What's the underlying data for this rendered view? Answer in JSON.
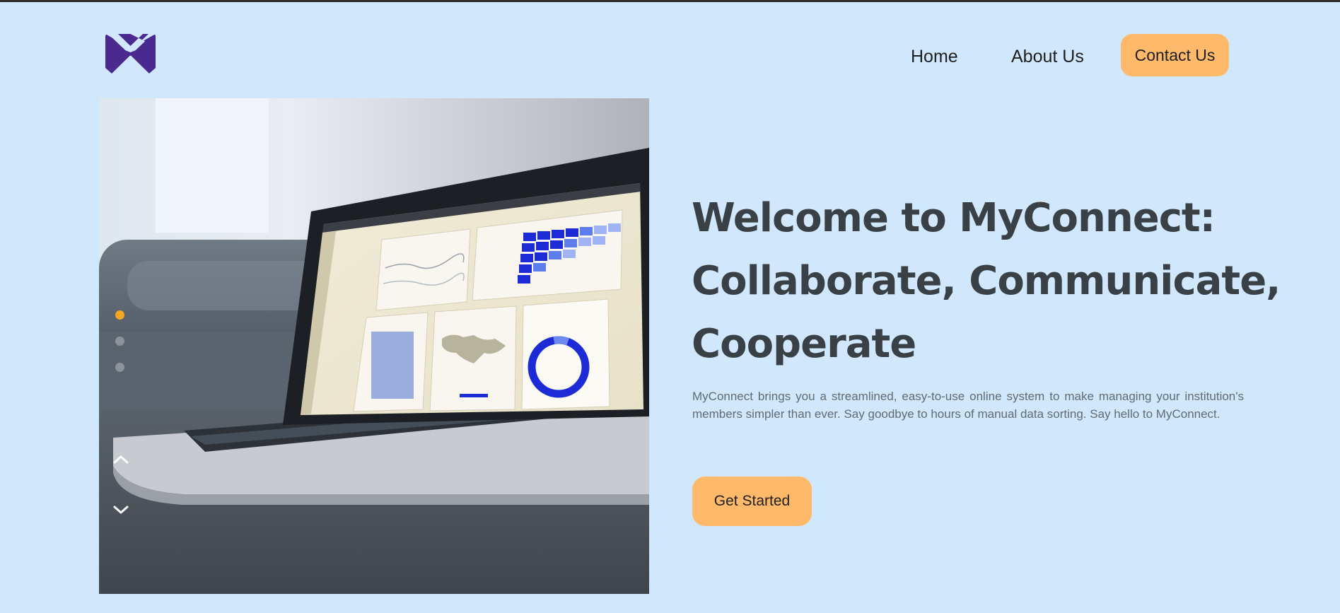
{
  "brand": {
    "logo_icon": "chevron-x-logo",
    "logo_color": "#4b2a8f"
  },
  "nav": {
    "home_label": "Home",
    "about_label": "About Us",
    "contact_label": "Contact Us"
  },
  "hero": {
    "image_subject": "laptop-analytics-dashboard",
    "slides": [
      {
        "active": true
      },
      {
        "active": false
      },
      {
        "active": false
      }
    ],
    "prev_icon": "chevron-up-icon",
    "next_icon": "chevron-down-icon"
  },
  "content": {
    "headline_line1": "Welcome to MyConnect:",
    "headline_line2": "Collaborate, Communicate,",
    "headline_line3": "Cooperate",
    "description": "MyConnect brings you a streamlined, easy-to-use online system to make managing your institution's members simpler than ever. Say goodbye to hours of manual data sorting. Say hello to MyConnect.",
    "cta_label": "Get Started"
  },
  "colors": {
    "background": "#d1e8fc",
    "accent": "#ffb96b",
    "heading": "#3a4146",
    "body_text": "#616b74",
    "dot_active": "#f5a623",
    "dot_inactive": "#8c939a"
  }
}
